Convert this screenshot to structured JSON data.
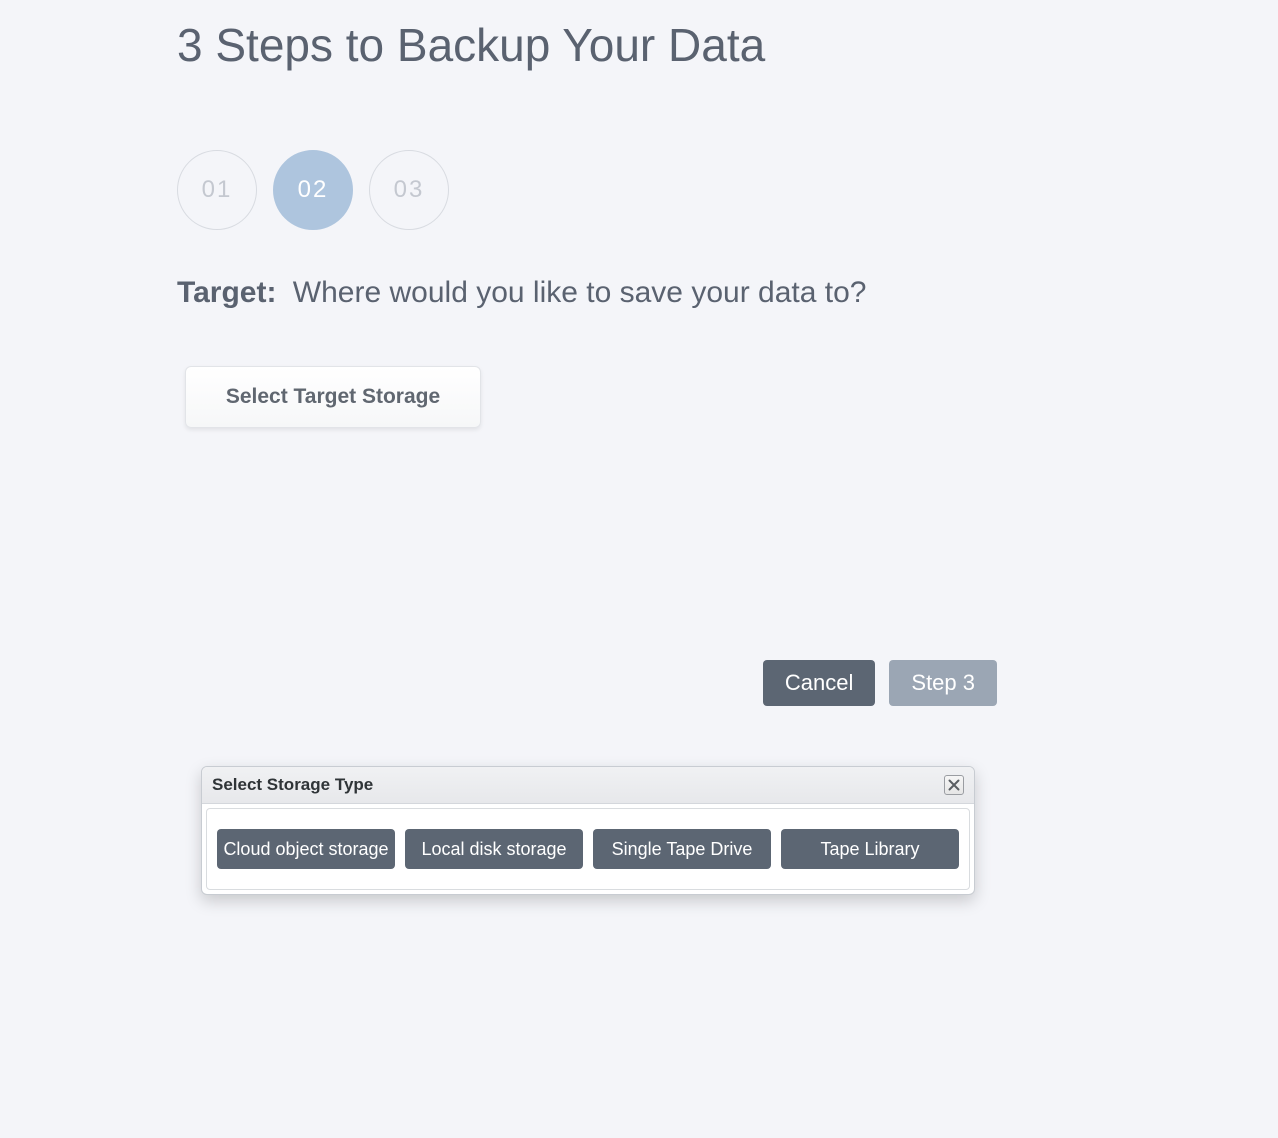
{
  "title": "3 Steps to Backup Your Data",
  "steps": [
    "01",
    "02",
    "03"
  ],
  "activeStep": 1,
  "question": {
    "label": "Target:",
    "text": "Where would you like to save your data to?"
  },
  "selectTargetLabel": "Select Target Storage",
  "nav": {
    "cancel": "Cancel",
    "next": "Step 3"
  },
  "dialog": {
    "title": "Select Storage Type",
    "options": [
      "Cloud object storage",
      "Local disk storage",
      "Single Tape Drive",
      "Tape Library"
    ]
  }
}
